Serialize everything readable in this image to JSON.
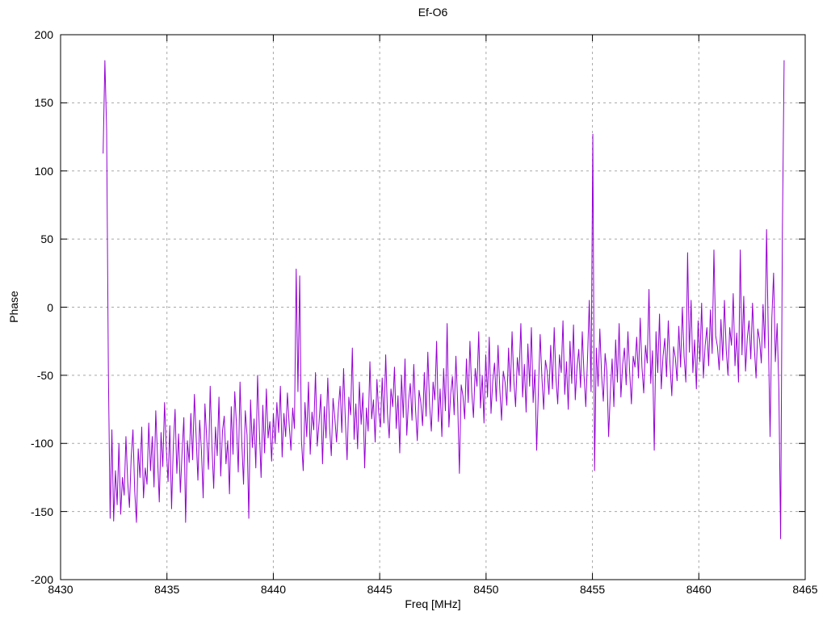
{
  "window": {
    "background": "#ffffff"
  },
  "chart_data": {
    "type": "line",
    "title": "Ef-O6",
    "xlabel": "Freq [MHz]",
    "ylabel": "Phase",
    "xlim": [
      8430,
      8465
    ],
    "ylim": [
      -200,
      200
    ],
    "xticks": [
      8430,
      8435,
      8440,
      8445,
      8450,
      8455,
      8460,
      8465
    ],
    "yticks": [
      -200,
      -150,
      -100,
      -50,
      0,
      50,
      100,
      150,
      200
    ],
    "grid": true,
    "legend_position": "none",
    "line_color": "#9400d3",
    "grid_color": "#a8a8a8",
    "border_color": "#000000",
    "series": [
      {
        "name": "Phase",
        "x_start": 8432.0,
        "x_step": 0.0825,
        "values": [
          113,
          181,
          130,
          -48,
          -155,
          -90,
          -157,
          -120,
          -145,
          -100,
          -152,
          -125,
          -138,
          -95,
          -128,
          -147,
          -110,
          -90,
          -135,
          -158,
          -104,
          -125,
          -88,
          -140,
          -118,
          -130,
          -85,
          -120,
          -95,
          -132,
          -76,
          -110,
          -143,
          -92,
          -117,
          -70,
          -104,
          -128,
          -87,
          -148,
          -101,
          -75,
          -122,
          -93,
          -136,
          -106,
          -81,
          -158,
          -98,
          -114,
          -78,
          -112,
          -64,
          -95,
          -127,
          -83,
          -105,
          -140,
          -71,
          -96,
          -119,
          -58,
          -102,
          -133,
          -88,
          -109,
          -66,
          -124,
          -91,
          -80,
          -115,
          -98,
          -137,
          -73,
          -108,
          -62,
          -87,
          -121,
          -55,
          -99,
          -130,
          -76,
          -94,
          -155,
          -68,
          -103,
          -82,
          -118,
          -50,
          -90,
          -125,
          -72,
          -107,
          -60,
          -96,
          -84,
          -113,
          -78,
          -100,
          -70,
          -92,
          -58,
          -110,
          -78,
          -95,
          -63,
          -86,
          -105,
          -74,
          -89,
          28,
          -62,
          23,
          -98,
          -120,
          -70,
          -95,
          -55,
          -108,
          -77,
          -90,
          -48,
          -102,
          -85,
          -64,
          -115,
          -73,
          -96,
          -52,
          -88,
          -109,
          -67,
          -81,
          -99,
          -75,
          -58,
          -92,
          -45,
          -83,
          -112,
          -66,
          -79,
          -30,
          -97,
          -71,
          -104,
          -55,
          -86,
          -63,
          -118,
          -74,
          -91,
          -40,
          -82,
          -68,
          -99,
          -53,
          -77,
          -88,
          -52,
          -85,
          -35,
          -78,
          -96,
          -60,
          -73,
          -44,
          -89,
          -65,
          -107,
          -50,
          -81,
          -38,
          -94,
          -69,
          -56,
          -83,
          -42,
          -75,
          -98,
          -61,
          -70,
          -87,
          -48,
          -80,
          -33,
          -72,
          -91,
          -55,
          -68,
          -25,
          -84,
          -60,
          -95,
          -45,
          -76,
          -12,
          -88,
          -64,
          -51,
          -79,
          -36,
          -70,
          -122,
          -57,
          -65,
          -82,
          -38,
          -70,
          -25,
          -62,
          -81,
          -45,
          -58,
          -18,
          -74,
          -50,
          -85,
          -35,
          -66,
          -22,
          -78,
          -54,
          -41,
          -69,
          -28,
          -60,
          -83,
          -47,
          -55,
          -72,
          -30,
          -62,
          -18,
          -54,
          -73,
          -37,
          -50,
          -12,
          -66,
          -42,
          -77,
          -27,
          -58,
          -15,
          -70,
          -46,
          -105,
          -61,
          -20,
          -52,
          -75,
          -39,
          -47,
          -64,
          -28,
          -60,
          -15,
          -52,
          -71,
          -35,
          -48,
          -10,
          -64,
          -40,
          -75,
          -25,
          -56,
          -13,
          -68,
          -44,
          -31,
          -59,
          -18,
          -50,
          -73,
          -37,
          5,
          -62,
          127,
          -120,
          -30,
          -58,
          -16,
          -50,
          -69,
          -34,
          -47,
          -95,
          -62,
          -38,
          -73,
          -24,
          -55,
          -12,
          -66,
          -42,
          -30,
          -57,
          -18,
          -48,
          -71,
          -36,
          -44,
          -22,
          -52,
          -8,
          -44,
          -63,
          -28,
          -41,
          13,
          -56,
          -32,
          -105,
          -18,
          -48,
          -5,
          -60,
          -36,
          -23,
          -51,
          -10,
          -42,
          -65,
          -29,
          -37,
          -54,
          -14,
          -44,
          0,
          -36,
          -55,
          40,
          -33,
          5,
          -48,
          -24,
          -60,
          -10,
          -40,
          3,
          -52,
          -28,
          -15,
          -43,
          -2,
          -34,
          42,
          -21,
          -29,
          -46,
          -9,
          -39,
          5,
          -31,
          -50,
          -15,
          -28,
          10,
          -43,
          -19,
          -55,
          42,
          -35,
          8,
          -47,
          -23,
          -10,
          -38,
          3,
          -29,
          -52,
          -16,
          -24,
          -41,
          2,
          -30,
          57,
          -22,
          -95,
          -8,
          25,
          -40,
          -12,
          -60,
          -170,
          55,
          181
        ]
      }
    ]
  }
}
